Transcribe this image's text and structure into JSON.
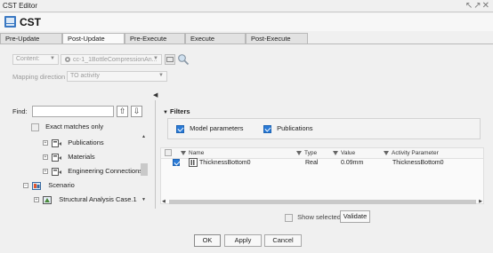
{
  "window": {
    "title": "CST Editor",
    "controls": "↖↗✕"
  },
  "header": {
    "app_title": "CST"
  },
  "tabs": [
    {
      "label": "Pre-Update",
      "active": false
    },
    {
      "label": "Post-Update",
      "active": true
    },
    {
      "label": "Pre-Execute",
      "active": false
    },
    {
      "label": "Execute",
      "active": false
    },
    {
      "label": "Post-Execute",
      "active": false
    }
  ],
  "content": {
    "label": "Content:",
    "select_value": "",
    "object_value": "cc-1_1BottleCompressionAn...",
    "mapping_label": "Mapping direction",
    "mapping_value": "TO activity"
  },
  "find": {
    "label": "Find:",
    "value": "",
    "up_icon": "arrow-up-icon",
    "down_icon": "arrow-down-icon",
    "exact_label": "Exact matches only",
    "exact_checked": false
  },
  "tree": {
    "items": [
      {
        "label": "Publications"
      },
      {
        "label": "Materials"
      },
      {
        "label": "Engineering Connections"
      },
      {
        "label": "Scenario"
      },
      {
        "label": "Structural Analysis Case.1"
      }
    ]
  },
  "filters": {
    "title": "Filters",
    "model_params_label": "Model parameters",
    "model_params_checked": true,
    "publications_label": "Publications",
    "publications_checked": true
  },
  "grid": {
    "columns": [
      "Name",
      "Type",
      "Value",
      "Activity Parameter"
    ],
    "rows": [
      {
        "checked": true,
        "name": "ThicknessBottom0",
        "type": "Real",
        "value": "0.09mm",
        "activity": "ThicknessBottom0"
      }
    ]
  },
  "bottom": {
    "show_selected_label": "Show selected",
    "validate_label": "Validate"
  },
  "footer": {
    "ok": "OK",
    "apply": "Apply",
    "cancel": "Cancel"
  },
  "colors": {
    "accent": "#2a7ad6",
    "tab_active": "#fafafa",
    "tab_inactive": "#e2e2e2"
  }
}
